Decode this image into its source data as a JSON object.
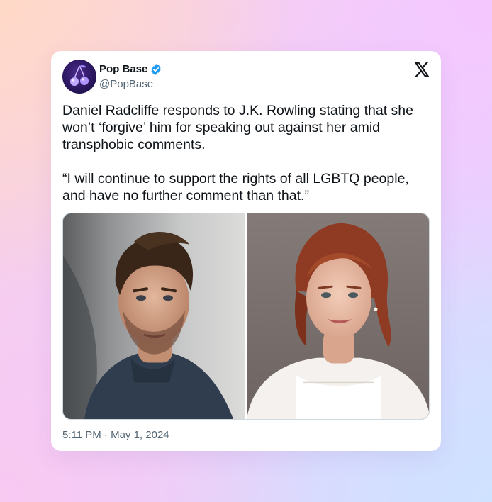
{
  "tweet": {
    "author": {
      "display_name": "Pop Base",
      "handle": "@PopBase",
      "verified": true,
      "avatar_icon": "cherries-logo"
    },
    "platform_icon": "x-logo",
    "text_paragraphs": [
      "Daniel Radcliffe responds to J.K. Rowling stating that she won’t ‘forgive’ him for speaking out against her amid transphobic comments.",
      "“I will continue to support the rights of all LGBTQ people, and have no further comment than that.”"
    ],
    "media": [
      {
        "description_icon": "man-portrait-photo"
      },
      {
        "description_icon": "woman-portrait-photo"
      }
    ],
    "timestamp": "5:11 PM · May 1, 2024"
  },
  "colors": {
    "text_primary": "#0f1419",
    "text_secondary": "#536471",
    "verified_blue": "#1d9bf0",
    "card_background": "#ffffff"
  }
}
